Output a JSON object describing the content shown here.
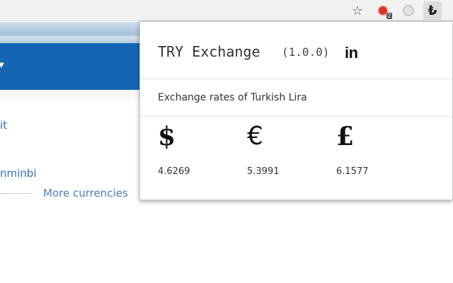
{
  "toolbar": {
    "star_icon": "star-icon",
    "extension_badge": "2",
    "active_extension_glyph": "₺"
  },
  "page": {
    "partial_link_1": "it",
    "partial_link_2": "nminbi",
    "more_currencies": "More currencies"
  },
  "popup": {
    "title": "TRY Exchange",
    "version": "(1.0.0)",
    "linkedin_label": "in",
    "description": "Exchange rates of Turkish Lira",
    "rates": [
      {
        "symbol": "$",
        "value": "4.6269"
      },
      {
        "symbol": "€",
        "value": "5.3991"
      },
      {
        "symbol": "£",
        "value": "6.1577"
      }
    ]
  },
  "colors": {
    "navbar": "#1565b5",
    "link": "#2f6fb5"
  }
}
